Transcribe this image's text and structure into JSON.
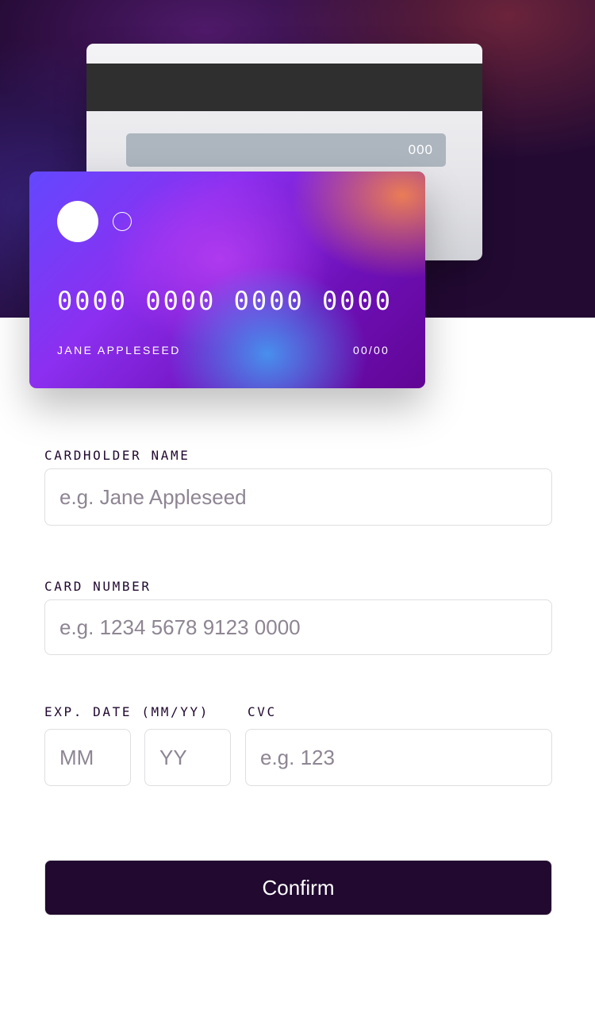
{
  "card": {
    "back": {
      "cvc": "000"
    },
    "front": {
      "number": "0000 0000 0000 0000",
      "holder": "JANE APPLESEED",
      "expiry": "00/00"
    }
  },
  "form": {
    "name_label": "CARDHOLDER NAME",
    "name_placeholder": "e.g. Jane Appleseed",
    "number_label": "CARD NUMBER",
    "number_placeholder": "e.g. 1234 5678 9123 0000",
    "exp_label": "EXP. DATE (MM/YY)",
    "mm_placeholder": "MM",
    "yy_placeholder": "YY",
    "cvc_label": "CVC",
    "cvc_placeholder": "e.g. 123",
    "confirm_label": "Confirm"
  },
  "colors": {
    "hero_background": "#230a33",
    "confirm_button": "#21092f",
    "input_border": "#dfdee0",
    "placeholder": "#8e8593"
  }
}
